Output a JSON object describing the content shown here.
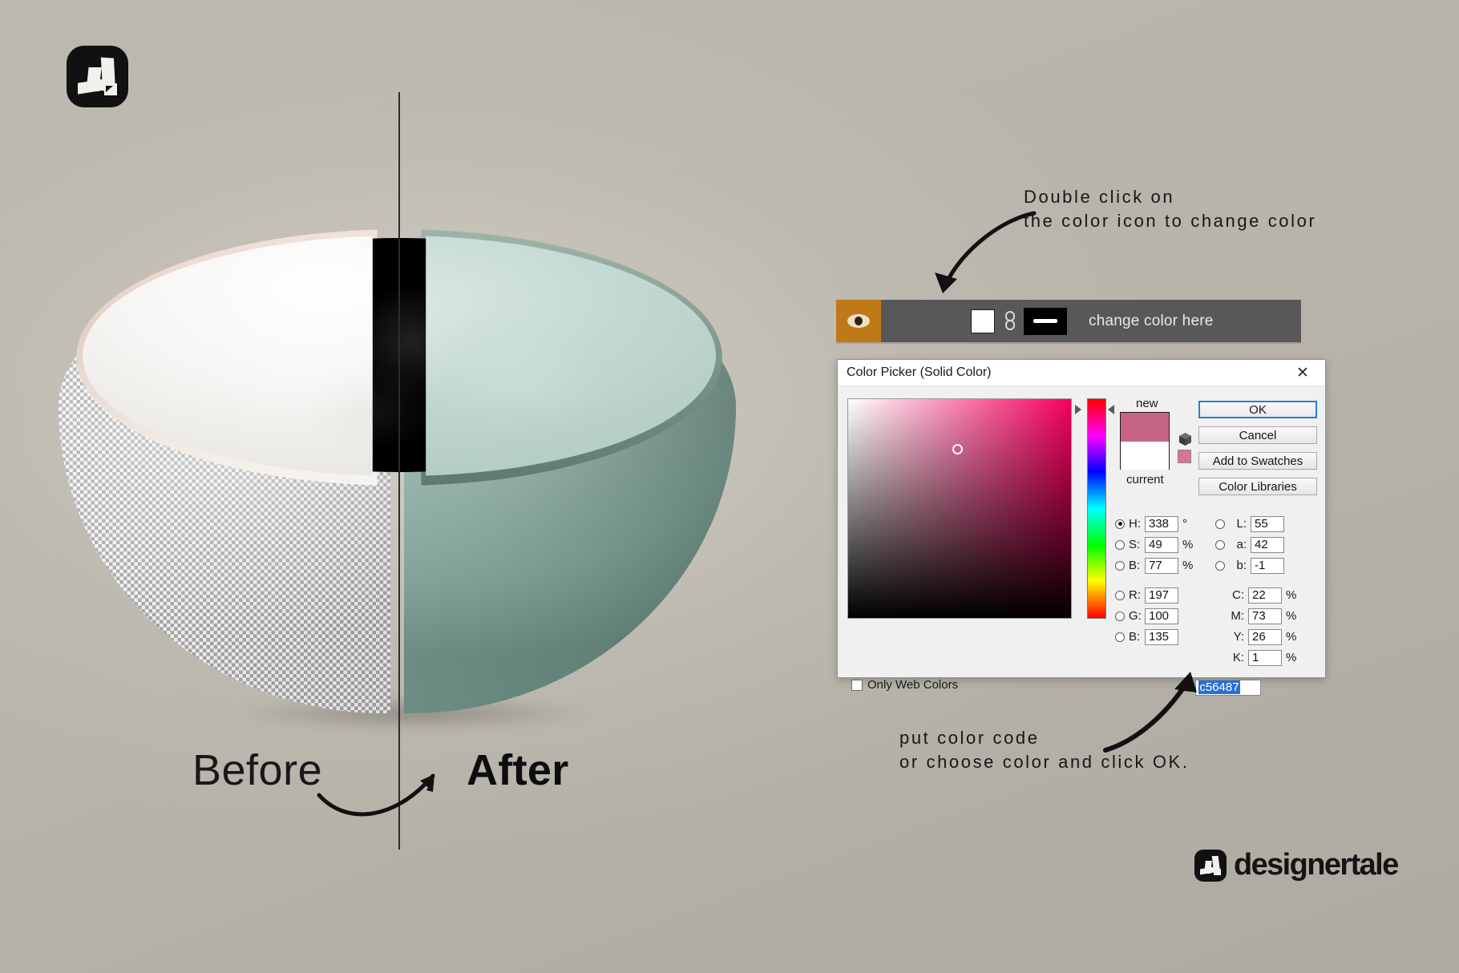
{
  "background_color": "#b9b5ac",
  "brand": {
    "mark_name": "designertale-logo-mark",
    "name": "designertale"
  },
  "comparison": {
    "before_label": "Before",
    "after_label": "After",
    "arrow_name": "before-after-arrow"
  },
  "annotations": {
    "top": {
      "line1": "Double click on",
      "line2": "the color icon to change color"
    },
    "bottom": {
      "line1": "put color code",
      "line2": "or choose color and click OK."
    }
  },
  "layer_bar": {
    "visibility_icon": "eye-icon",
    "visibility_bg": "#bf7918",
    "color_swatch": "#ffffff",
    "link_icon": "link-icon",
    "mask_thumbnail": "layer-mask-thumbnail",
    "layer_name": "change color here",
    "bar_bg": "#585858"
  },
  "picker": {
    "title": "Color Picker (Solid Color)",
    "close_label": "✕",
    "new_label": "new",
    "current_label": "current",
    "new_color": "#c56487",
    "current_color": "#ffffff",
    "mini_swatch_color": "#d9738f",
    "buttons": {
      "ok": "OK",
      "cancel": "Cancel",
      "add_to_swatches": "Add to Swatches",
      "color_libraries": "Color Libraries"
    },
    "only_web_colors": {
      "label": "Only Web Colors",
      "checked": false
    },
    "hex": {
      "hash": "#",
      "value": "c56487",
      "selected": true
    },
    "fields": {
      "hsb": [
        {
          "label": "H:",
          "value": "338",
          "unit": "°",
          "selected": true
        },
        {
          "label": "S:",
          "value": "49",
          "unit": "%",
          "selected": false
        },
        {
          "label": "B:",
          "value": "77",
          "unit": "%",
          "selected": false
        }
      ],
      "rgb": [
        {
          "label": "R:",
          "value": "197",
          "unit": "",
          "selected": false
        },
        {
          "label": "G:",
          "value": "100",
          "unit": "",
          "selected": false
        },
        {
          "label": "B:",
          "value": "135",
          "unit": "",
          "selected": false
        }
      ],
      "lab": [
        {
          "label": "L:",
          "value": "55",
          "unit": "",
          "selected": false
        },
        {
          "label": "a:",
          "value": "42",
          "unit": "",
          "selected": false
        },
        {
          "label": "b:",
          "value": "-1",
          "unit": "",
          "selected": false
        }
      ],
      "cmyk": [
        {
          "label": "C:",
          "value": "22",
          "unit": "%"
        },
        {
          "label": "M:",
          "value": "73",
          "unit": "%"
        },
        {
          "label": "Y:",
          "value": "26",
          "unit": "%"
        },
        {
          "label": "K:",
          "value": "1",
          "unit": "%"
        }
      ]
    },
    "sv_marker": {
      "saturation_pct": 49,
      "brightness_pct": 77
    }
  }
}
